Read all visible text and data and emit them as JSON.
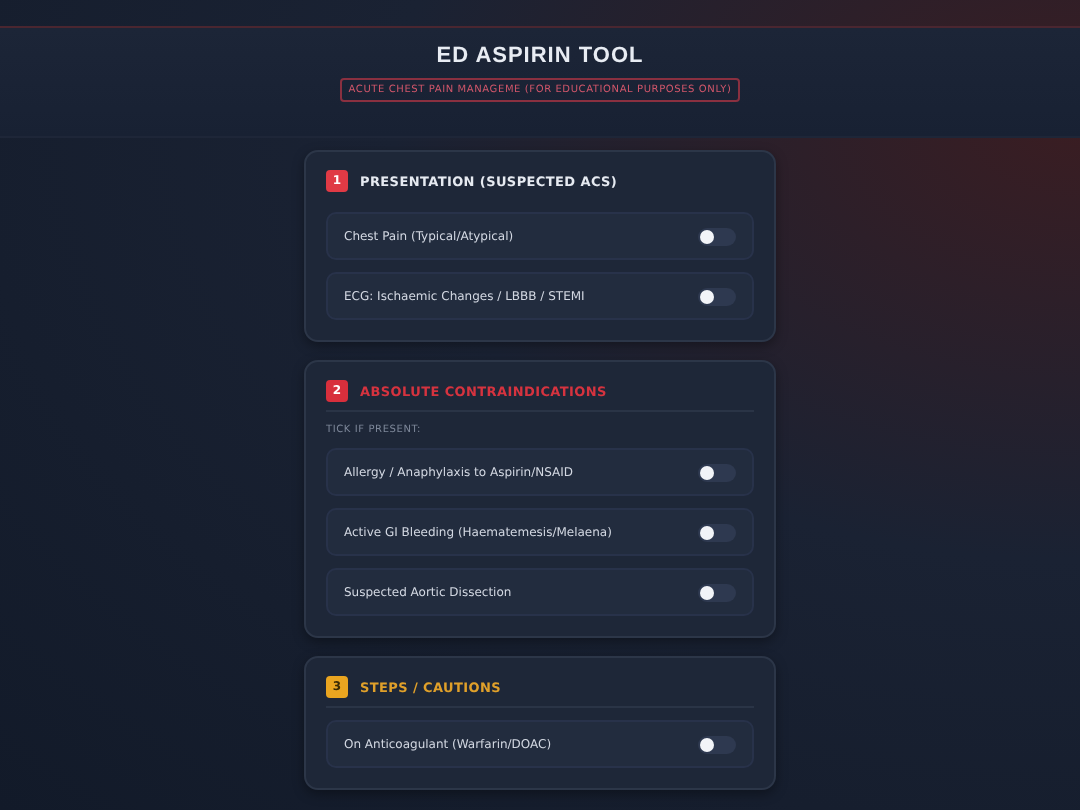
{
  "header": {
    "title": "ED ASPIRIN TOOL",
    "subtitle": "ACUTE CHEST PAIN MANAGEME (FOR EDUCATIONAL PURPOSES ONLY)"
  },
  "sections": [
    {
      "number": "1",
      "kind": "presentation",
      "title": "PRESENTATION (SUSPECTED ACS)",
      "items": [
        {
          "label": "Chest Pain (Typical/Atypical)",
          "on": false
        },
        {
          "label": "ECG: Ischaemic Changes / LBBB / STEMI",
          "on": false
        }
      ]
    },
    {
      "number": "2",
      "kind": "contraindication",
      "title": "ABSOLUTE CONTRAINDICATIONS",
      "hint": "TICK IF PRESENT:",
      "items": [
        {
          "label": "Allergy / Anaphylaxis to Aspirin/NSAID",
          "on": false
        },
        {
          "label": "Active GI Bleeding (Haematemesis/Melaena)",
          "on": false
        },
        {
          "label": "Suspected Aortic Dissection",
          "on": false
        }
      ]
    },
    {
      "number": "3",
      "kind": "caution",
      "title": "STEPS / CAUTIONS",
      "items": [
        {
          "label": "On Anticoagulant (Warfarin/DOAC)",
          "on": false
        }
      ]
    }
  ]
}
